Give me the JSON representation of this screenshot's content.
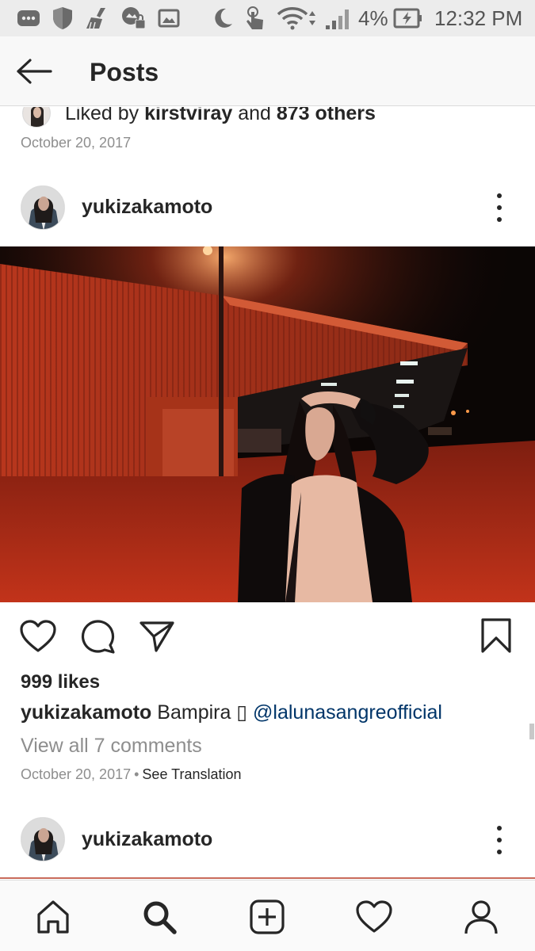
{
  "status_bar": {
    "battery": "4%",
    "time": "12:32 PM",
    "icons": [
      "messages-icon",
      "shield-icon",
      "cleaner-icon",
      "photo-lock-icon",
      "image-icon",
      "moon-icon",
      "touch-icon",
      "wifi-icon",
      "signal-icon",
      "battery-charging-icon"
    ]
  },
  "header": {
    "title": "Posts",
    "back_icon": "arrow-left-icon"
  },
  "previous_post": {
    "liked_prefix": "Liked by ",
    "liked_user": "kirstviray",
    "liked_mid": " and ",
    "liked_count": "873 others",
    "date": "October 20, 2017"
  },
  "post": {
    "username": "yukizakamoto",
    "likes": "999 likes",
    "caption_user": "yukizakamoto",
    "caption_text": " Bampira ▯ ",
    "caption_mention": "@lalunasangreofficial",
    "view_comments": "View all 7 comments",
    "date": "October 20, 2017",
    "separator": "•",
    "see_translation": "See Translation",
    "actions": [
      "heart-icon",
      "comment-icon",
      "share-icon",
      "bookmark-icon"
    ]
  },
  "next_post": {
    "username": "yukizakamoto"
  },
  "bottom_nav": {
    "items": [
      "home-icon",
      "search-icon",
      "add-post-icon",
      "activity-heart-icon",
      "profile-icon"
    ]
  },
  "colors": {
    "text": "#262626",
    "muted": "#8e8e8e",
    "mention": "#003569",
    "status_bar_bg": "#ececec"
  }
}
